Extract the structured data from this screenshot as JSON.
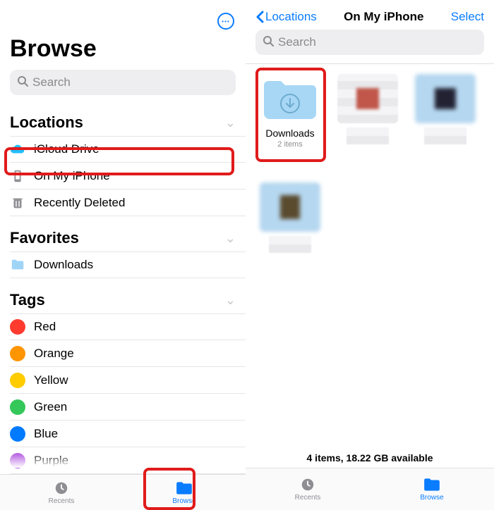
{
  "left": {
    "title": "Browse",
    "search_placeholder": "Search",
    "sections": {
      "locations": {
        "title": "Locations",
        "items": [
          {
            "icon": "cloud",
            "label": "iCloud Drive"
          },
          {
            "icon": "phone",
            "label": "On My iPhone"
          },
          {
            "icon": "trash",
            "label": "Recently Deleted"
          }
        ]
      },
      "favorites": {
        "title": "Favorites",
        "items": [
          {
            "icon": "folder",
            "label": "Downloads"
          }
        ]
      },
      "tags": {
        "title": "Tags",
        "items": [
          {
            "color": "#ff3b30",
            "label": "Red"
          },
          {
            "color": "#ff9500",
            "label": "Orange"
          },
          {
            "color": "#ffcc00",
            "label": "Yellow"
          },
          {
            "color": "#34c759",
            "label": "Green"
          },
          {
            "color": "#007aff",
            "label": "Blue"
          },
          {
            "color": "#af52de",
            "label": "Purple"
          }
        ]
      }
    },
    "tabs": {
      "recents": "Recents",
      "browse": "Browse",
      "active": "browse"
    }
  },
  "right": {
    "back_label": "Locations",
    "title": "On My iPhone",
    "select_label": "Select",
    "search_placeholder": "Search",
    "grid": [
      {
        "kind": "folder-download",
        "name": "Downloads",
        "meta": "2 items"
      },
      {
        "kind": "pixelated",
        "name": "",
        "meta": ""
      },
      {
        "kind": "pixelated",
        "name": "",
        "meta": ""
      },
      {
        "kind": "pixelated",
        "name": "",
        "meta": ""
      }
    ],
    "status": "4 items, 18.22 GB available",
    "tabs": {
      "recents": "Recents",
      "browse": "Browse",
      "active": "browse"
    }
  }
}
